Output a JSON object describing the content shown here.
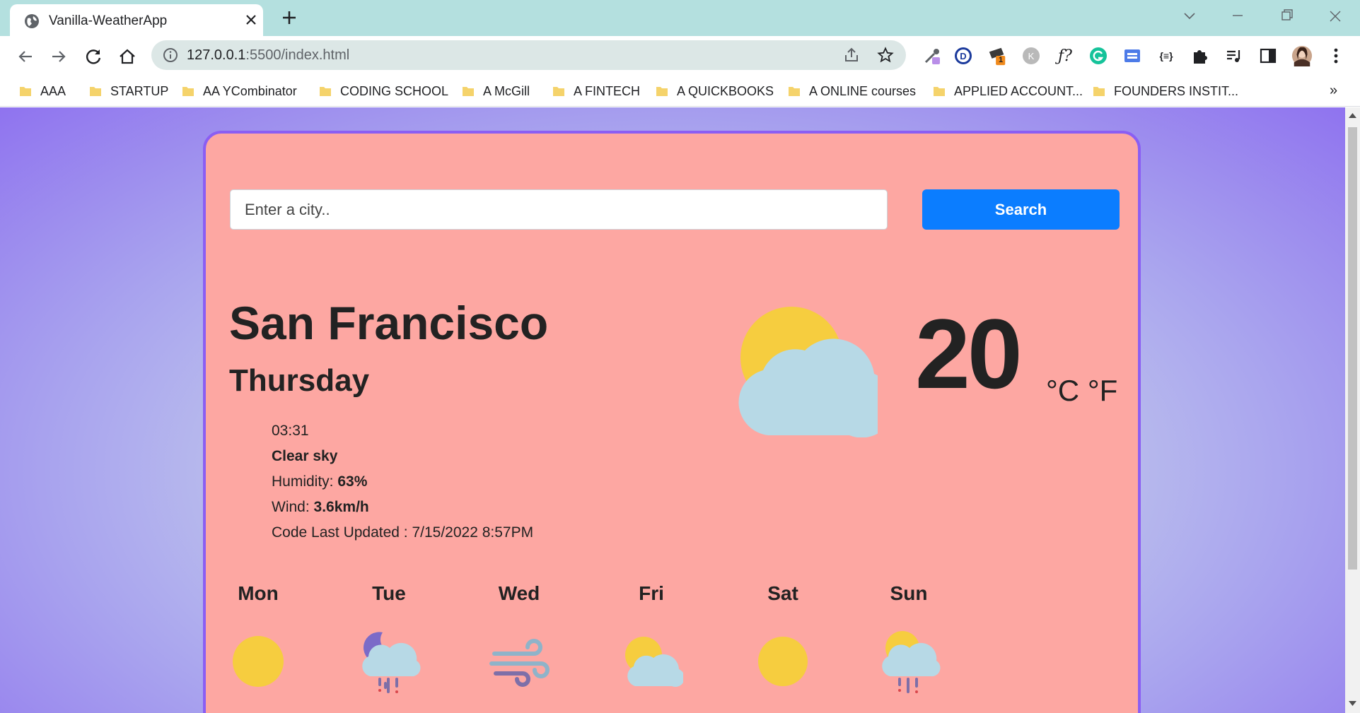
{
  "browser": {
    "tab_title": "Vanilla-WeatherApp",
    "url_host": "127.0.0.1",
    "url_rest": ":5500/index.html",
    "extension_badge": "1",
    "bookmarks": [
      "AAA",
      "STARTUP",
      "AA YCombinator",
      "CODING SCHOOL",
      "A McGill",
      "A FINTECH",
      "A QUICKBOOKS",
      "A ONLINE courses",
      "APPLIED ACCOUNT...",
      "FOUNDERS INSTIT..."
    ],
    "bookmarks_more": "»"
  },
  "search": {
    "placeholder": "Enter a city..",
    "button_label": "Search"
  },
  "current": {
    "city": "San Francisco",
    "day": "Thursday",
    "time": "03:31",
    "description": "Clear sky",
    "humidity_label": "Humidity:",
    "humidity_value": "63%",
    "wind_label": "Wind:",
    "wind_value": "3.6km/h",
    "updated_label": "Code Last Updated : 7/15/2022 8:57PM",
    "icon": "partly-cloudy-day-icon",
    "temperature": "20",
    "unit_c": "°C",
    "unit_f": "°F"
  },
  "forecast": [
    {
      "day": "Mon",
      "icon": "sun-icon"
    },
    {
      "day": "Tue",
      "icon": "rain-night-icon"
    },
    {
      "day": "Wed",
      "icon": "wind-icon"
    },
    {
      "day": "Fri",
      "icon": "partly-cloudy-icon"
    },
    {
      "day": "Sat",
      "icon": "sun-icon"
    },
    {
      "day": "Sun",
      "icon": "rain-day-icon"
    }
  ],
  "colors": {
    "card_bg": "#fda7a2",
    "card_border": "#8b5ef3",
    "search_button": "#0b7dff",
    "sun": "#f6cd3f",
    "cloud": "#b7d9e6",
    "tab_strip": "#b4e0df"
  }
}
